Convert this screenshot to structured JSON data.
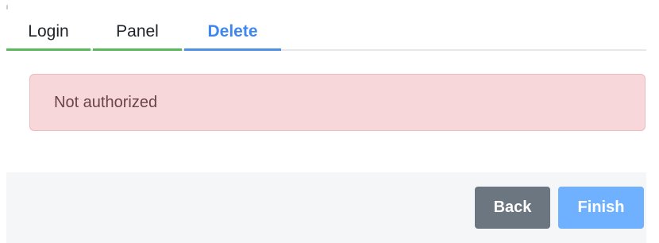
{
  "tabs": [
    {
      "label": "Login",
      "state": "completed"
    },
    {
      "label": "Panel",
      "state": "completed"
    },
    {
      "label": "Delete",
      "state": "active"
    }
  ],
  "alert": {
    "message": "Not authorized",
    "type": "danger"
  },
  "footer": {
    "back_label": "Back",
    "finish_label": "Finish"
  },
  "colors": {
    "completed_tab_underline": "#5cb85c",
    "active_tab": "#3f86f0",
    "alert_background": "#f8d7da",
    "back_button": "#6b7680",
    "finish_button": "#6fb1ff"
  }
}
